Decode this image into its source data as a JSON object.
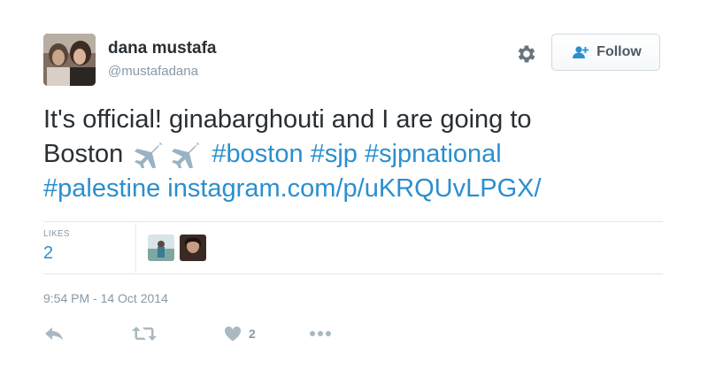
{
  "user": {
    "name": "dana mustafa",
    "handle": "@mustafadana"
  },
  "follow_button": {
    "label": "Follow"
  },
  "tweet": {
    "text_line1": "It's official! ginabarghouti and I are going to",
    "text_word_boston": "Boston",
    "hashtags": [
      "#boston",
      "#sjp",
      "#sjpnational",
      "#palestine"
    ],
    "link": "instagram.com/p/uKRQUvLPGX/"
  },
  "stats": {
    "likes_label": "LIKES",
    "likes_count": "2"
  },
  "timestamp": "9:54 PM - 14 Oct 2014",
  "actions": {
    "like_count": "2"
  },
  "colors": {
    "link": "#2b8fcf",
    "text": "#292f33",
    "muted": "#8899a6",
    "divider": "#e1e8ed"
  },
  "icons": [
    "gear-icon",
    "follow-person-icon",
    "airplane-emoji",
    "reply-icon",
    "retweet-icon",
    "heart-icon",
    "more-icon"
  ]
}
